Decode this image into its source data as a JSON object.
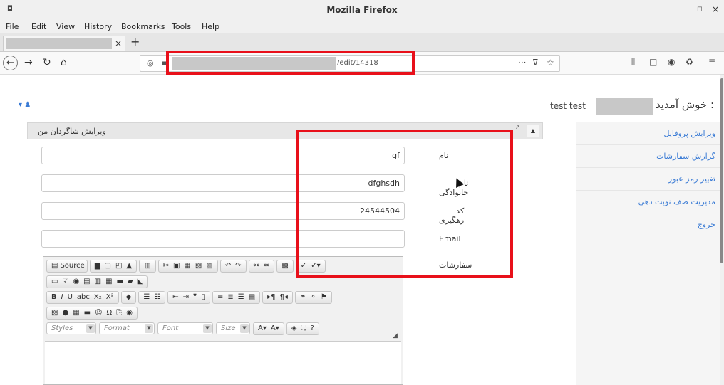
{
  "window": {
    "title": "Mozilla Firefox",
    "icon": "firefox-icon",
    "minimize": "_",
    "maximize": "◻",
    "close": "×"
  },
  "menu": [
    "File",
    "Edit",
    "View",
    "History",
    "Bookmarks",
    "Tools",
    "Help"
  ],
  "tab": {
    "close": "×",
    "new": "+"
  },
  "nav": {
    "url_visible": "/edit/14318",
    "more": "···"
  },
  "page": {
    "welcome": "خوش آمدید :",
    "user_name": "test test",
    "panel_title": "ویرایش شاگردان من"
  },
  "sidebar": {
    "items": [
      "ویرایش پروفایل",
      "گزارش سفارشات",
      "تغییر رمز عبور",
      "مدیریت صف نوبت دهی",
      "خروج"
    ]
  },
  "form": {
    "fields": [
      {
        "label": "نام",
        "value": "gf"
      },
      {
        "label": "نام خانوادگی",
        "value": "dfghsdh"
      },
      {
        "label": "کد رهگیری",
        "value": "24544504"
      },
      {
        "label": "Email",
        "value": ""
      },
      {
        "label": "سفارشات",
        "value": ""
      }
    ]
  },
  "editor": {
    "source": "Source",
    "combos": [
      "Styles",
      "Format",
      "Font",
      "Size"
    ]
  },
  "colors": {
    "highlight": "#e8101a",
    "link": "#3a7bd5"
  }
}
